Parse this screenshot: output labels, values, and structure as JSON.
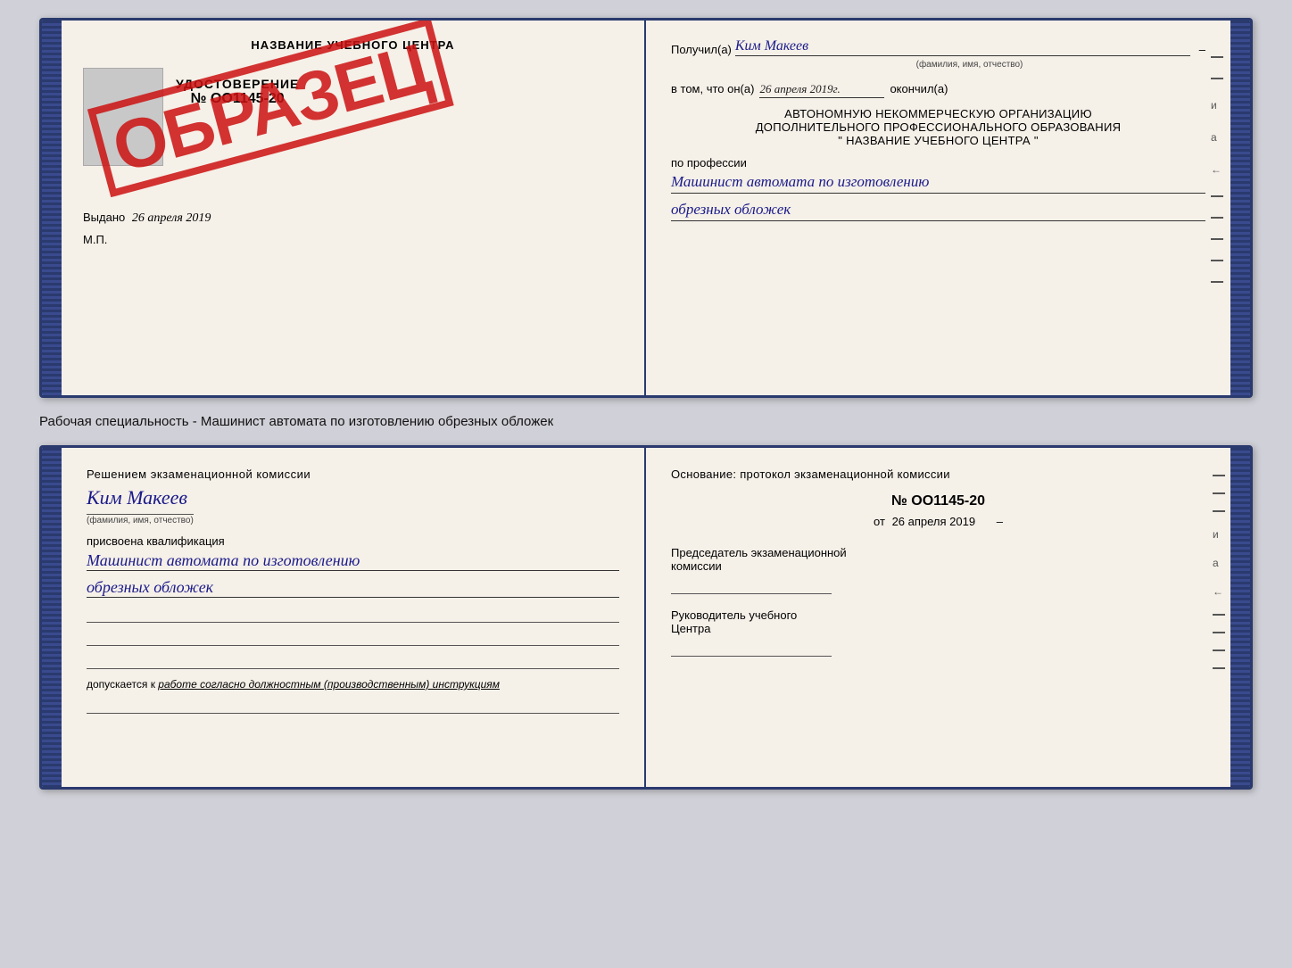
{
  "top_doc": {
    "left": {
      "title": "НАЗВАНИЕ УЧЕБНОГО ЦЕНТРА",
      "udostoverenie_label": "УДОСТОВЕРЕНИЕ",
      "number": "№ OO1145-20",
      "vydano_label": "Выдано",
      "vydano_date": "26 апреля 2019",
      "mp_label": "М.П.",
      "stamp": "ОБРАЗЕЦ"
    },
    "right": {
      "poluchil_label": "Получил(а)",
      "poluchil_name": "Ким Макеев",
      "fio_subtitle": "(фамилия, имя, отчество)",
      "vtom_label": "в том, что он(а)",
      "vtom_date": "26 апреля 2019г.",
      "okonchil_label": "окончил(а)",
      "org_line1": "АВТОНОМНУЮ НЕКОММЕРЧЕСКУЮ ОРГАНИЗАЦИЮ",
      "org_line2": "ДОПОЛНИТЕЛЬНОГО ПРОФЕССИОНАЛЬНОГО ОБРАЗОВАНИЯ",
      "org_quote_open": "\"",
      "org_name": "НАЗВАНИЕ УЧЕБНОГО ЦЕНТРА",
      "org_quote_close": "\"",
      "po_professii_label": "по профессии",
      "profession_line1": "Машинист автомата по изготовлению",
      "profession_line2": "обрезных обложек"
    }
  },
  "caption": "Рабочая специальность - Машинист автомата по изготовлению обрезных обложек",
  "bottom_doc": {
    "left": {
      "resheniem_text": "Решением  экзаменационной  комиссии",
      "name": "Ким Макеев",
      "fio_subtitle": "(фамилия, имя, отчество)",
      "prisvoena_label": "присвоена квалификация",
      "qualification_line1": "Машинист автомата по изготовлению",
      "qualification_line2": "обрезных обложек",
      "dopuskaetsya_label": "допускается к",
      "dopuskaetsya_italic": "работе согласно должностным (производственным) инструкциям"
    },
    "right": {
      "osnovaniye_label": "Основание: протокол экзаменационной  комиссии",
      "protocol_number": "№  OO1145-20",
      "ot_prefix": "от",
      "ot_date": "26 апреля 2019",
      "predsedatel_line1": "Председатель экзаменационной",
      "predsedatel_line2": "комиссии",
      "rukovoditel_line1": "Руководитель учебного",
      "rukovoditel_line2": "Центра"
    }
  },
  "dashes": [
    "-",
    "-",
    "-",
    "и",
    "a",
    "←",
    "-",
    "-",
    "-",
    "-"
  ]
}
